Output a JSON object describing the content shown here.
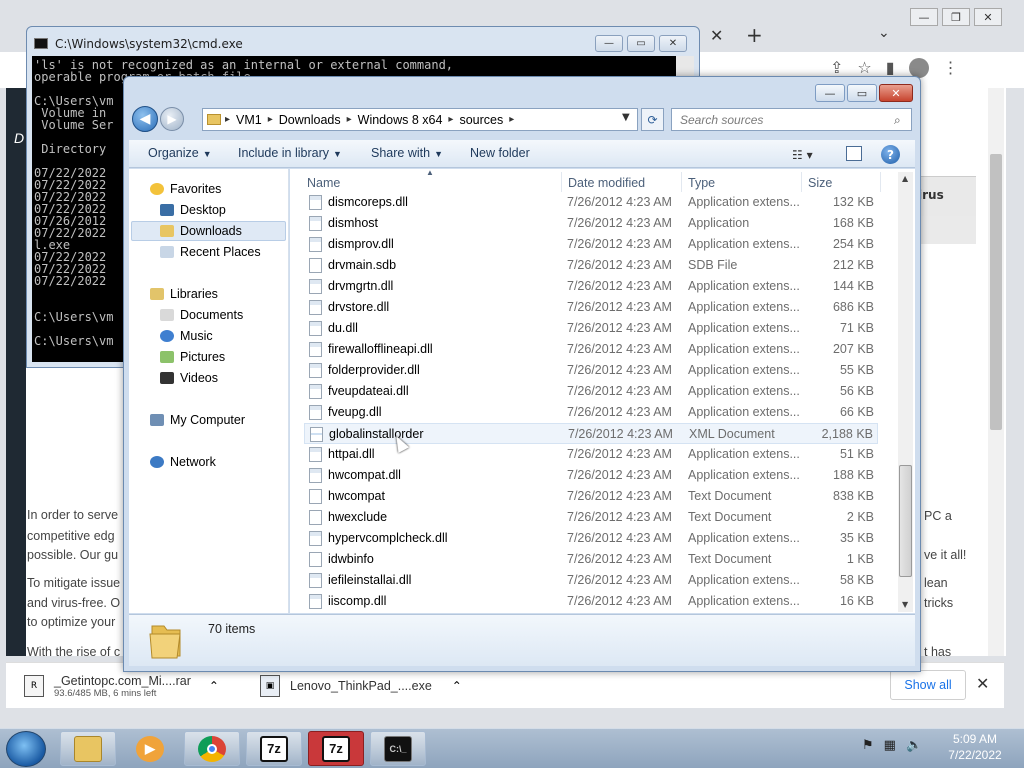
{
  "browser": {
    "new_tab_symbol": "+",
    "page_text_left": [
      "In order to serve",
      "competitive edg",
      "possible. Our gu",
      "To mitigate issue",
      "and virus-free. O",
      "to optimize your",
      "With the rise of c"
    ],
    "page_text_right": [
      "PC a",
      "ve it all!",
      "lean",
      "tricks",
      "t has"
    ],
    "page_d_letter": "D",
    "banner_text": "irus",
    "downloads": [
      {
        "name": "_Getintopc.com_Mi....rar",
        "meta": "93.6/485 MB, 6 mins left"
      },
      {
        "name": "Lenovo_ThinkPad_....exe",
        "meta": ""
      }
    ],
    "show_all_label": "Show all"
  },
  "cmd": {
    "title": "C:\\Windows\\system32\\cmd.exe",
    "lines": [
      "'ls' is not recognized as an internal or external command,",
      "operable program or batch file.",
      "",
      "C:\\Users\\vm",
      " Volume in",
      " Volume Ser",
      "",
      " Directory",
      "",
      "07/22/2022",
      "07/22/2022",
      "07/22/2022",
      "07/22/2022",
      "07/26/2012",
      "07/22/2022",
      "l.exe",
      "07/22/2022",
      "07/22/2022",
      "07/22/2022",
      "",
      "",
      "C:\\Users\\vm",
      "",
      "C:\\Users\\vm"
    ]
  },
  "explorer": {
    "address": [
      "VM1",
      "Downloads",
      "Windows 8 x64",
      "sources"
    ],
    "search_placeholder": "Search sources",
    "commands": {
      "organize": "Organize",
      "include": "Include in library",
      "share": "Share with",
      "new_folder": "New folder"
    },
    "nav": {
      "favorites": "Favorites",
      "desktop": "Desktop",
      "downloads": "Downloads",
      "recent": "Recent Places",
      "libraries": "Libraries",
      "documents": "Documents",
      "music": "Music",
      "pictures": "Pictures",
      "videos": "Videos",
      "computer": "My Computer",
      "network": "Network"
    },
    "columns": {
      "name": "Name",
      "date": "Date modified",
      "type": "Type",
      "size": "Size"
    },
    "files": [
      {
        "name": "dismcoreps.dll",
        "date": "7/26/2012 4:23 AM",
        "type": "Application extens...",
        "size": "132 KB",
        "icon": "app"
      },
      {
        "name": "dismhost",
        "date": "7/26/2012 4:23 AM",
        "type": "Application",
        "size": "168 KB",
        "icon": "app"
      },
      {
        "name": "dismprov.dll",
        "date": "7/26/2012 4:23 AM",
        "type": "Application extens...",
        "size": "254 KB",
        "icon": "app"
      },
      {
        "name": "drvmain.sdb",
        "date": "7/26/2012 4:23 AM",
        "type": "SDB File",
        "size": "212 KB",
        "icon": "file"
      },
      {
        "name": "drvmgrtn.dll",
        "date": "7/26/2012 4:23 AM",
        "type": "Application extens...",
        "size": "144 KB",
        "icon": "app"
      },
      {
        "name": "drvstore.dll",
        "date": "7/26/2012 4:23 AM",
        "type": "Application extens...",
        "size": "686 KB",
        "icon": "app"
      },
      {
        "name": "du.dll",
        "date": "7/26/2012 4:23 AM",
        "type": "Application extens...",
        "size": "71 KB",
        "icon": "app"
      },
      {
        "name": "firewallofflineapi.dll",
        "date": "7/26/2012 4:23 AM",
        "type": "Application extens...",
        "size": "207 KB",
        "icon": "app"
      },
      {
        "name": "folderprovider.dll",
        "date": "7/26/2012 4:23 AM",
        "type": "Application extens...",
        "size": "55 KB",
        "icon": "app"
      },
      {
        "name": "fveupdateai.dll",
        "date": "7/26/2012 4:23 AM",
        "type": "Application extens...",
        "size": "56 KB",
        "icon": "app"
      },
      {
        "name": "fveupg.dll",
        "date": "7/26/2012 4:23 AM",
        "type": "Application extens...",
        "size": "66 KB",
        "icon": "app"
      },
      {
        "name": "globalinstallorder",
        "date": "7/26/2012 4:23 AM",
        "type": "XML Document",
        "size": "2,188 KB",
        "icon": "xml"
      },
      {
        "name": "httpai.dll",
        "date": "7/26/2012 4:23 AM",
        "type": "Application extens...",
        "size": "51 KB",
        "icon": "app"
      },
      {
        "name": "hwcompat.dll",
        "date": "7/26/2012 4:23 AM",
        "type": "Application extens...",
        "size": "188 KB",
        "icon": "app"
      },
      {
        "name": "hwcompat",
        "date": "7/26/2012 4:23 AM",
        "type": "Text Document",
        "size": "838 KB",
        "icon": "file"
      },
      {
        "name": "hwexclude",
        "date": "7/26/2012 4:23 AM",
        "type": "Text Document",
        "size": "2 KB",
        "icon": "file"
      },
      {
        "name": "hypervcomplcheck.dll",
        "date": "7/26/2012 4:23 AM",
        "type": "Application extens...",
        "size": "35 KB",
        "icon": "app"
      },
      {
        "name": "idwbinfo",
        "date": "7/26/2012 4:23 AM",
        "type": "Text Document",
        "size": "1 KB",
        "icon": "file"
      },
      {
        "name": "iefileinstallai.dll",
        "date": "7/26/2012 4:23 AM",
        "type": "Application extens...",
        "size": "58 KB",
        "icon": "app"
      },
      {
        "name": "iiscomp.dll",
        "date": "7/26/2012 4:23 AM",
        "type": "Application extens...",
        "size": "16 KB",
        "icon": "app"
      }
    ],
    "status": "70 items"
  },
  "taskbar": {
    "apps": [
      "explorer",
      "media-player",
      "chrome",
      "7zip",
      "7zip-active",
      "cmd"
    ],
    "clock_time": "5:09 AM",
    "clock_date": "7/22/2022"
  }
}
